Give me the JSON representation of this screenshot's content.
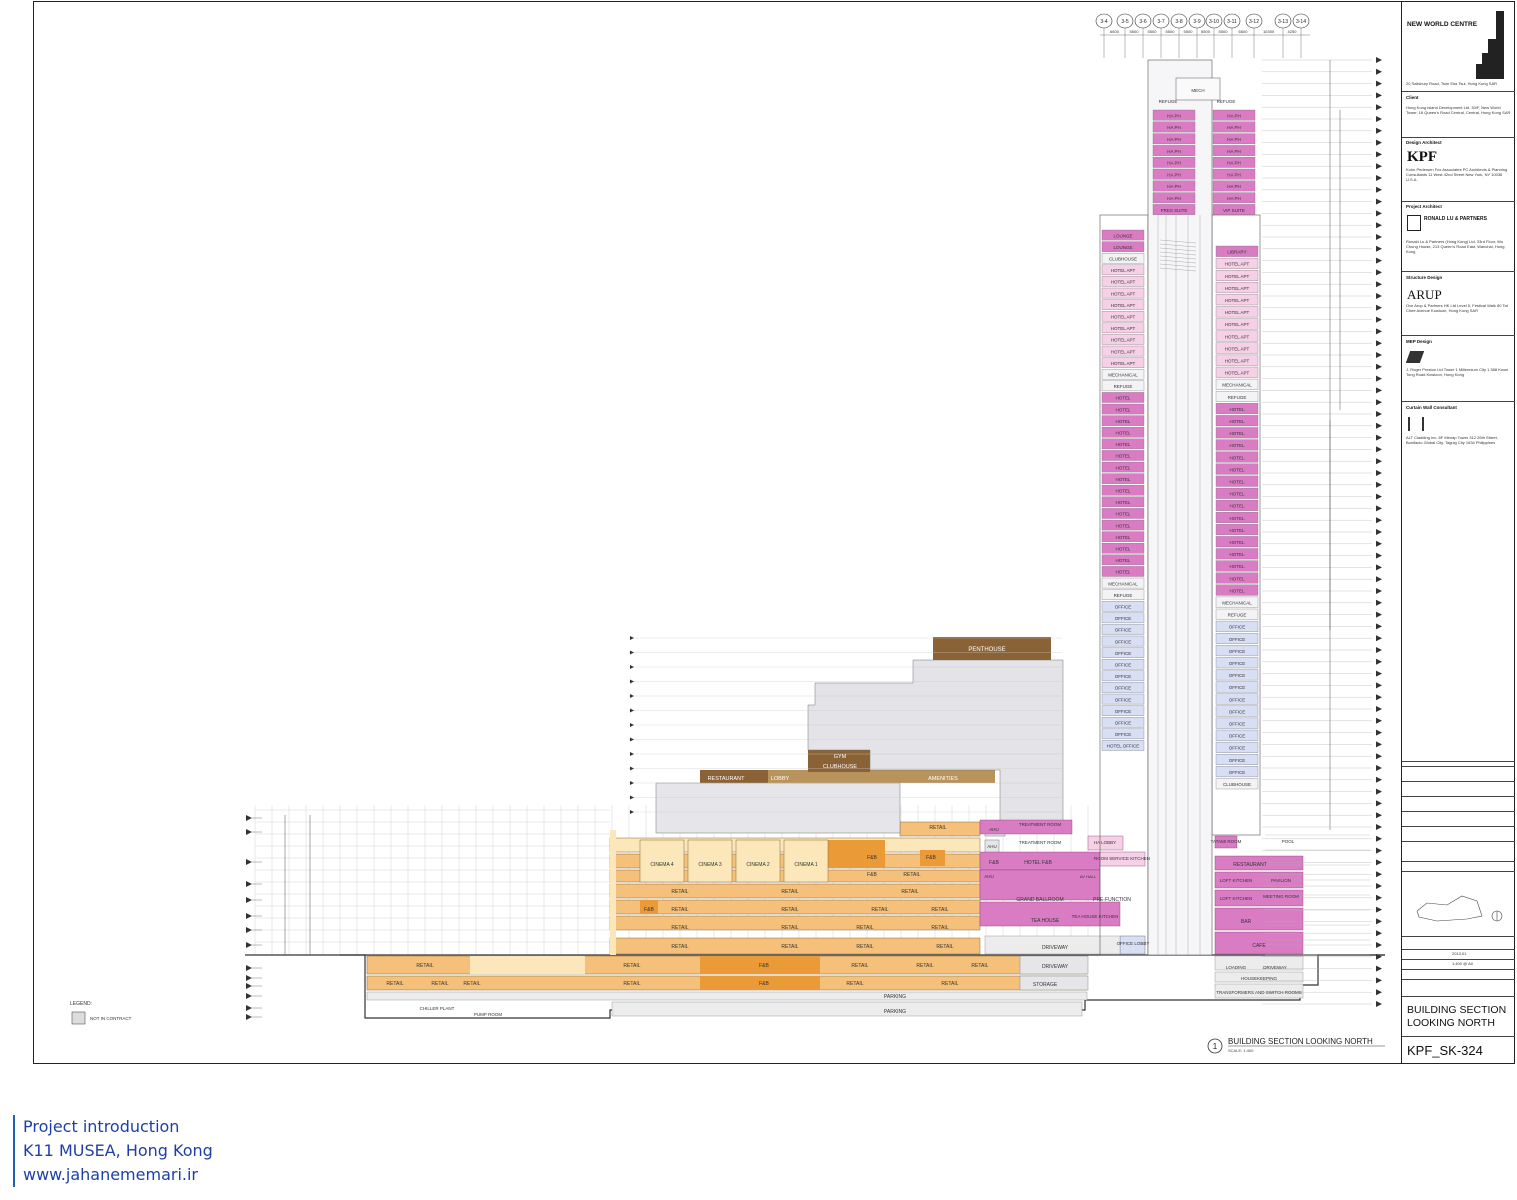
{
  "drawing": {
    "caption_number": "1",
    "caption_title": "BUILDING SECTION LOOKING NORTH",
    "caption_scale": "SCALE: 1:400",
    "legend_title": "LEGEND:",
    "legend_item": "NOT IN CONTRACT",
    "sheet_number": "KPF_SK-324",
    "sheet_title_1": "BUILDING SECTION",
    "sheet_title_2": "LOOKING NORTH",
    "gridlines": [
      "3-4",
      "3-5",
      "3-6",
      "3-7",
      "3-8",
      "3-9",
      "3-10",
      "3-11",
      "3-12",
      "3-13",
      "3-14"
    ],
    "grid_dims": [
      "6600",
      "5500",
      "5500",
      "5500",
      "5500",
      "5500",
      "5500",
      "6600",
      "10350",
      "4250"
    ],
    "tower_left": [
      "LOUNGE",
      "LOUNGE",
      "CLUBHOUSE",
      "HOTEL APT",
      "HOTEL APT",
      "HOTEL APT",
      "HOTEL APT",
      "HOTEL APT",
      "HOTEL APT",
      "HOTEL APT",
      "HOTEL APT",
      "HOTEL APT",
      "MECHANICAL",
      "REFUGE",
      "HOTEL",
      "HOTEL",
      "HOTEL",
      "HOTEL",
      "HOTEL",
      "HOTEL",
      "HOTEL",
      "HOTEL",
      "HOTEL",
      "HOTEL",
      "HOTEL",
      "HOTEL",
      "HOTEL",
      "HOTEL",
      "HOTEL",
      "HOTEL",
      "MECHANICAL",
      "REFUGE",
      "OFFICE",
      "OFFICE",
      "OFFICE",
      "OFFICE",
      "OFFICE",
      "OFFICE",
      "OFFICE",
      "OFFICE",
      "OFFICE",
      "OFFICE",
      "OFFICE",
      "OFFICE",
      "HOTEL OFFICE"
    ],
    "tower_right": [
      "LIBRARY",
      "HOTEL APT",
      "HOTEL APT",
      "HOTEL APT",
      "HOTEL APT",
      "HOTEL APT",
      "HOTEL APT",
      "HOTEL APT",
      "HOTEL APT",
      "HOTEL APT",
      "HOTEL APT",
      "MECHANICAL",
      "REFUGE",
      "HOTEL",
      "HOTEL",
      "HOTEL",
      "HOTEL",
      "HOTEL",
      "HOTEL",
      "HOTEL",
      "HOTEL",
      "HOTEL",
      "HOTEL",
      "HOTEL",
      "HOTEL",
      "HOTEL",
      "HOTEL",
      "HOTEL",
      "HOTEL",
      "MECHANICAL",
      "REFUGE",
      "OFFICE",
      "OFFICE",
      "OFFICE",
      "OFFICE",
      "OFFICE",
      "OFFICE",
      "OFFICE",
      "OFFICE",
      "OFFICE",
      "OFFICE",
      "OFFICE",
      "OFFICE",
      "OFFICE",
      "CLUBHOUSE"
    ],
    "top_left": [
      "HA PH",
      "HA PH",
      "HA PH",
      "HA PH",
      "HA PH",
      "HA PH",
      "HA PH",
      "HA PH",
      "PRES SUITE"
    ],
    "top_right": [
      "HA PH",
      "HA PH",
      "HA PH",
      "HA PH",
      "HA PH",
      "HA PH",
      "HA PH",
      "HA PH",
      "VIP SUITE"
    ],
    "mech_label": "MECH",
    "refuge_label": "REFUGE",
    "penthouse": "PENTHOUSE",
    "restaurant_upper": "RESTAURANT",
    "lobby_upper": "LOBBY",
    "gym": "GYM",
    "clubhouse_upper": "CLUBHOUSE",
    "amenities": "AMENITIES",
    "cinemas": [
      "CINEMA 4",
      "CINEMA 3",
      "CINEMA 2",
      "CINEMA 1"
    ],
    "retail": "RETAIL",
    "fb": "F&B",
    "ahu": "AHU",
    "treatment_room": "TREATMENT ROOM",
    "ha_lobby": "HA LOBBY",
    "hotel_fb": "HOTEL F&B",
    "room_service": "ROOM SERVICE KITCHEN",
    "grand_ballroom": "GRAND BALLROOM",
    "av_hall": "AV HALL",
    "pre_function": "PRE-FUNCTION",
    "tea_house": "TEA HOUSE",
    "tea_house_kitchen": "TEA HOUSE KITCHEN",
    "driveway": "DRIVEWAY",
    "office_lobby": "OFFICE LOBBY",
    "tatami_room": "TATAMI ROOM",
    "pool": "POOL",
    "restaurant_right": "RESTAURANT",
    "loft_kitchen": "LOFT KITCHEN",
    "pavilion": "PAVILION",
    "meeting_room": "MEETING ROOM",
    "bar": "BAR",
    "cafe": "CAFE",
    "loading": "LOADING",
    "housekeeping": "HOUSEKEEPING",
    "transformers": "TRANSFORMERS AND SWITCH ROOMS",
    "parking": "PARKING",
    "storage": "STORAGE",
    "chiller": "CHILLER PLANT",
    "pump_room": "PUMP ROOM"
  },
  "title_block": {
    "project": "NEW WORLD CENTRE",
    "address": "20 Salisbury Road, Tsim Sha Tsui, Hong Kong SAR",
    "client_head": "Client",
    "client": "Hong Kong Island Development Ltd. 30/F, New World Tower, 16 Queen's Road Central, Central, Hong Kong SAR",
    "design_head": "Design Architect",
    "kpf": "KPF",
    "kpf_text": "Kohn Pedersen Fox Associates PC Architects & Planning Consultants 11 West 42nd Street New York, NY 10036 U.S.A.",
    "project_arch_head": "Project Architect",
    "rlp": "RONALD LU & PARTNERS",
    "rlp_text": "Ronald Lu & Partners (Hong Kong) Ltd. 33rd Floor, Wu Chung House, 213 Queen's Road East, Wanchai, Hong Kong",
    "struct_head": "Structure Design",
    "arup": "ARUP",
    "arup_text": "Ove Arup & Partners HK Ltd Level 5, Festival Walk 80 Tat Chee Avenue Kowloon, Hong Kong SAR",
    "mep_head": "MEP Design",
    "mep_text": "J. Roger Preston Ltd Tower 1 Millennium City 1 388 Kwun Tong Road Kowloon, Hong Kong",
    "cw_head": "Curtain Wall Consultant",
    "cw_text": "ALT Cladding Inc. 8F Menap Tower 312 26th Street, Bonifacio Global City, Taguig City 1634 Philippines",
    "date_value": "2013.01",
    "scale_value": "1:400 @ A0"
  },
  "footer": {
    "line1": "Project introduction",
    "line2": "K11 MUSEA, Hong Kong",
    "line3": "www.jahanememari.ir"
  },
  "colors": {
    "pink": "#d97cc4",
    "hotel_pale": "#f5d0e6",
    "office_blue": "#d8dff4",
    "retail_orange": "#f4c07a",
    "dark_orange": "#ea9a36",
    "cream": "#fbe7b9",
    "brown": "#8a6235",
    "tan": "#b8935c",
    "grey": "#e6e6ea"
  }
}
